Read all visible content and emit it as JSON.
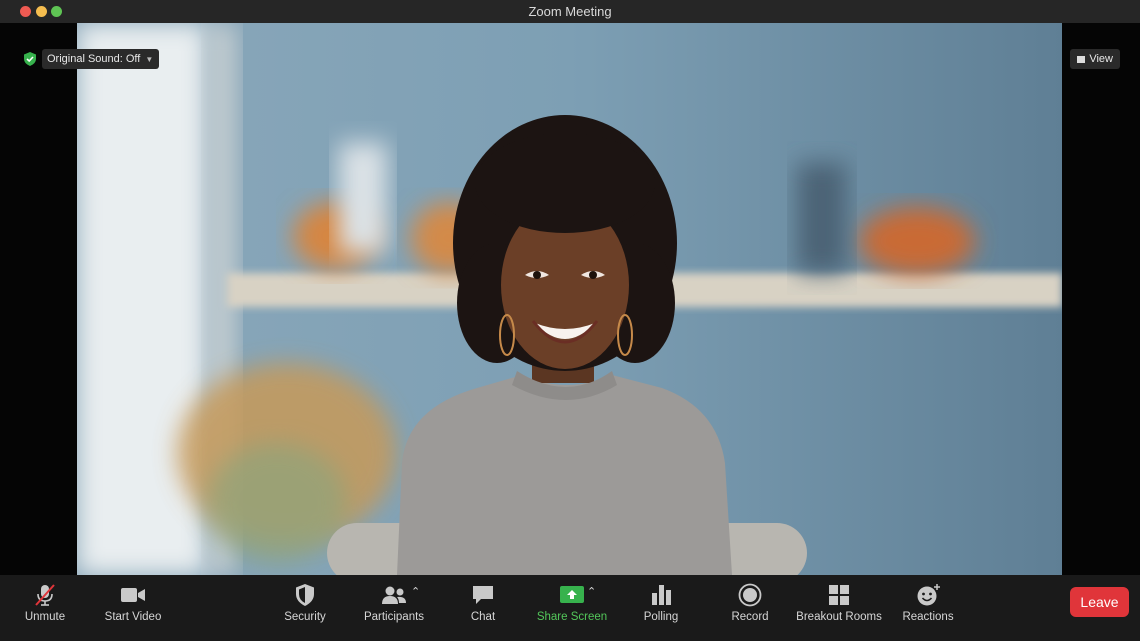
{
  "window": {
    "title": "Zoom Meeting"
  },
  "overlay": {
    "sound_label": "Original Sound: Off",
    "view_label": "View"
  },
  "toolbar": {
    "unmute": "Unmute",
    "start_video": "Start Video",
    "security": "Security",
    "participants": "Participants",
    "chat": "Chat",
    "share_screen": "Share Screen",
    "polling": "Polling",
    "record": "Record",
    "breakout_rooms": "Breakout Rooms",
    "reactions": "Reactions",
    "leave": "Leave"
  },
  "colors": {
    "accent_green": "#53c75a",
    "leave_red": "#e0353a",
    "toolbar_bg": "#1a1a1a"
  },
  "icons": [
    "microphone-muted-icon",
    "video-camera-icon",
    "shield-icon",
    "participants-icon",
    "chat-icon",
    "share-screen-icon",
    "polling-icon",
    "record-icon",
    "breakout-rooms-icon",
    "reactions-icon"
  ]
}
